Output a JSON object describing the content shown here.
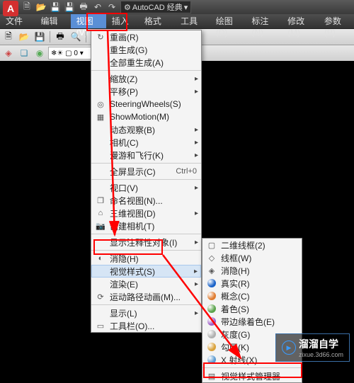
{
  "workspace_label": "AutoCAD 经典",
  "menubar": {
    "items": [
      {
        "label": "文件(F)"
      },
      {
        "label": "编辑(E)"
      },
      {
        "label": "视图(V)"
      },
      {
        "label": "插入(I)"
      },
      {
        "label": "格式(O)"
      },
      {
        "label": "工具(T)"
      },
      {
        "label": "绘图(D)"
      },
      {
        "label": "标注(N)"
      },
      {
        "label": "修改(M)"
      },
      {
        "label": "参数(P)"
      }
    ]
  },
  "dropdown": {
    "items": [
      {
        "icon": "redraw-icon",
        "label": "重画(R)",
        "submenu": false
      },
      {
        "icon": "",
        "label": "重生成(G)",
        "submenu": false
      },
      {
        "icon": "",
        "label": "全部重生成(A)",
        "submenu": false
      },
      {
        "sep": true
      },
      {
        "icon": "",
        "label": "缩放(Z)",
        "submenu": true
      },
      {
        "icon": "",
        "label": "平移(P)",
        "submenu": true
      },
      {
        "icon": "wheel-icon",
        "label": "SteeringWheels(S)",
        "submenu": false
      },
      {
        "icon": "film-icon",
        "label": "ShowMotion(M)",
        "submenu": false
      },
      {
        "icon": "",
        "label": "动态观察(B)",
        "submenu": true
      },
      {
        "icon": "",
        "label": "相机(C)",
        "submenu": true
      },
      {
        "icon": "",
        "label": "漫游和飞行(K)",
        "submenu": true
      },
      {
        "sep": true
      },
      {
        "icon": "",
        "label": "全屏显示(C)",
        "shortcut": "Ctrl+0",
        "submenu": false
      },
      {
        "sep": true
      },
      {
        "icon": "",
        "label": "视口(V)",
        "submenu": true
      },
      {
        "icon": "namedview-icon",
        "label": "命名视图(N)...",
        "submenu": false
      },
      {
        "icon": "home3d-icon",
        "label": "三维视图(D)",
        "submenu": true
      },
      {
        "icon": "camera-icon",
        "label": "创建相机(T)",
        "submenu": false
      },
      {
        "sep": true
      },
      {
        "icon": "",
        "label": "显示注释性对象(I)",
        "submenu": true
      },
      {
        "sep": true
      },
      {
        "icon": "hide-icon",
        "label": "消隐(H)",
        "submenu": false
      },
      {
        "icon": "",
        "label": "视觉样式(S)",
        "submenu": true,
        "hov": true
      },
      {
        "icon": "",
        "label": "渲染(E)",
        "submenu": true
      },
      {
        "icon": "motion-icon",
        "label": "运动路径动画(M)...",
        "submenu": false
      },
      {
        "sep": true
      },
      {
        "icon": "",
        "label": "显示(L)",
        "submenu": true
      },
      {
        "icon": "toolbar-icon",
        "label": "工具栏(O)...",
        "submenu": false
      }
    ]
  },
  "submenu": {
    "items": [
      {
        "icon": "wire2d-icon",
        "label": "二维线框(2)"
      },
      {
        "icon": "wire3d-icon",
        "label": "线框(W)"
      },
      {
        "icon": "hidden-icon",
        "label": "消隐(H)"
      },
      {
        "icon": "realistic-icon",
        "color": "#1b63c9",
        "label": "真实(R)"
      },
      {
        "icon": "conceptual-icon",
        "color": "#e07b2f",
        "label": "概念(C)"
      },
      {
        "icon": "shaded-icon",
        "color": "#5aa34b",
        "label": "着色(S)"
      },
      {
        "icon": "shadedge-icon",
        "color": "#9f5fc7",
        "label": "带边缘着色(E)"
      },
      {
        "icon": "gray-icon",
        "color": "#b0b0b0",
        "label": "灰度(G)"
      },
      {
        "icon": "sketch-icon",
        "color": "#d9a13a",
        "label": "勾画(K)"
      },
      {
        "icon": "xray-icon",
        "color": "#5c9bd1",
        "label": "X 射线(X)"
      },
      {
        "sep": true
      },
      {
        "icon": "vsmgr-icon",
        "label": "视觉样式管理器"
      }
    ]
  },
  "watermark": {
    "brand": "溜溜自学",
    "sub": "zixue.3d66.com"
  }
}
